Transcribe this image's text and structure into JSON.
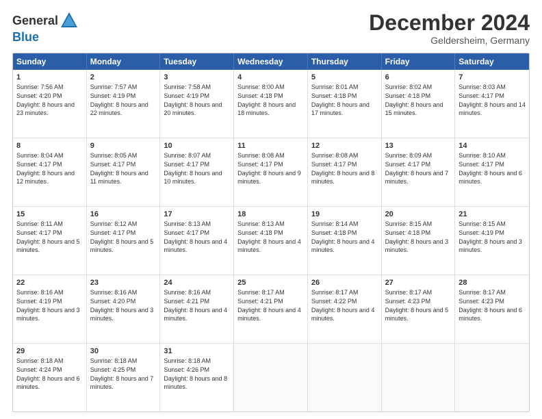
{
  "header": {
    "logo_general": "General",
    "logo_blue": "Blue",
    "month_title": "December 2024",
    "location": "Geldersheim, Germany"
  },
  "weekdays": [
    "Sunday",
    "Monday",
    "Tuesday",
    "Wednesday",
    "Thursday",
    "Friday",
    "Saturday"
  ],
  "rows": [
    [
      {
        "day": "1",
        "sunrise": "Sunrise: 7:56 AM",
        "sunset": "Sunset: 4:20 PM",
        "daylight": "Daylight: 8 hours and 23 minutes."
      },
      {
        "day": "2",
        "sunrise": "Sunrise: 7:57 AM",
        "sunset": "Sunset: 4:19 PM",
        "daylight": "Daylight: 8 hours and 22 minutes."
      },
      {
        "day": "3",
        "sunrise": "Sunrise: 7:58 AM",
        "sunset": "Sunset: 4:19 PM",
        "daylight": "Daylight: 8 hours and 20 minutes."
      },
      {
        "day": "4",
        "sunrise": "Sunrise: 8:00 AM",
        "sunset": "Sunset: 4:18 PM",
        "daylight": "Daylight: 8 hours and 18 minutes."
      },
      {
        "day": "5",
        "sunrise": "Sunrise: 8:01 AM",
        "sunset": "Sunset: 4:18 PM",
        "daylight": "Daylight: 8 hours and 17 minutes."
      },
      {
        "day": "6",
        "sunrise": "Sunrise: 8:02 AM",
        "sunset": "Sunset: 4:18 PM",
        "daylight": "Daylight: 8 hours and 15 minutes."
      },
      {
        "day": "7",
        "sunrise": "Sunrise: 8:03 AM",
        "sunset": "Sunset: 4:17 PM",
        "daylight": "Daylight: 8 hours and 14 minutes."
      }
    ],
    [
      {
        "day": "8",
        "sunrise": "Sunrise: 8:04 AM",
        "sunset": "Sunset: 4:17 PM",
        "daylight": "Daylight: 8 hours and 12 minutes."
      },
      {
        "day": "9",
        "sunrise": "Sunrise: 8:05 AM",
        "sunset": "Sunset: 4:17 PM",
        "daylight": "Daylight: 8 hours and 11 minutes."
      },
      {
        "day": "10",
        "sunrise": "Sunrise: 8:07 AM",
        "sunset": "Sunset: 4:17 PM",
        "daylight": "Daylight: 8 hours and 10 minutes."
      },
      {
        "day": "11",
        "sunrise": "Sunrise: 8:08 AM",
        "sunset": "Sunset: 4:17 PM",
        "daylight": "Daylight: 8 hours and 9 minutes."
      },
      {
        "day": "12",
        "sunrise": "Sunrise: 8:08 AM",
        "sunset": "Sunset: 4:17 PM",
        "daylight": "Daylight: 8 hours and 8 minutes."
      },
      {
        "day": "13",
        "sunrise": "Sunrise: 8:09 AM",
        "sunset": "Sunset: 4:17 PM",
        "daylight": "Daylight: 8 hours and 7 minutes."
      },
      {
        "day": "14",
        "sunrise": "Sunrise: 8:10 AM",
        "sunset": "Sunset: 4:17 PM",
        "daylight": "Daylight: 8 hours and 6 minutes."
      }
    ],
    [
      {
        "day": "15",
        "sunrise": "Sunrise: 8:11 AM",
        "sunset": "Sunset: 4:17 PM",
        "daylight": "Daylight: 8 hours and 5 minutes."
      },
      {
        "day": "16",
        "sunrise": "Sunrise: 8:12 AM",
        "sunset": "Sunset: 4:17 PM",
        "daylight": "Daylight: 8 hours and 5 minutes."
      },
      {
        "day": "17",
        "sunrise": "Sunrise: 8:13 AM",
        "sunset": "Sunset: 4:17 PM",
        "daylight": "Daylight: 8 hours and 4 minutes."
      },
      {
        "day": "18",
        "sunrise": "Sunrise: 8:13 AM",
        "sunset": "Sunset: 4:18 PM",
        "daylight": "Daylight: 8 hours and 4 minutes."
      },
      {
        "day": "19",
        "sunrise": "Sunrise: 8:14 AM",
        "sunset": "Sunset: 4:18 PM",
        "daylight": "Daylight: 8 hours and 4 minutes."
      },
      {
        "day": "20",
        "sunrise": "Sunrise: 8:15 AM",
        "sunset": "Sunset: 4:18 PM",
        "daylight": "Daylight: 8 hours and 3 minutes."
      },
      {
        "day": "21",
        "sunrise": "Sunrise: 8:15 AM",
        "sunset": "Sunset: 4:19 PM",
        "daylight": "Daylight: 8 hours and 3 minutes."
      }
    ],
    [
      {
        "day": "22",
        "sunrise": "Sunrise: 8:16 AM",
        "sunset": "Sunset: 4:19 PM",
        "daylight": "Daylight: 8 hours and 3 minutes."
      },
      {
        "day": "23",
        "sunrise": "Sunrise: 8:16 AM",
        "sunset": "Sunset: 4:20 PM",
        "daylight": "Daylight: 8 hours and 3 minutes."
      },
      {
        "day": "24",
        "sunrise": "Sunrise: 8:16 AM",
        "sunset": "Sunset: 4:21 PM",
        "daylight": "Daylight: 8 hours and 4 minutes."
      },
      {
        "day": "25",
        "sunrise": "Sunrise: 8:17 AM",
        "sunset": "Sunset: 4:21 PM",
        "daylight": "Daylight: 8 hours and 4 minutes."
      },
      {
        "day": "26",
        "sunrise": "Sunrise: 8:17 AM",
        "sunset": "Sunset: 4:22 PM",
        "daylight": "Daylight: 8 hours and 4 minutes."
      },
      {
        "day": "27",
        "sunrise": "Sunrise: 8:17 AM",
        "sunset": "Sunset: 4:23 PM",
        "daylight": "Daylight: 8 hours and 5 minutes."
      },
      {
        "day": "28",
        "sunrise": "Sunrise: 8:17 AM",
        "sunset": "Sunset: 4:23 PM",
        "daylight": "Daylight: 8 hours and 6 minutes."
      }
    ],
    [
      {
        "day": "29",
        "sunrise": "Sunrise: 8:18 AM",
        "sunset": "Sunset: 4:24 PM",
        "daylight": "Daylight: 8 hours and 6 minutes."
      },
      {
        "day": "30",
        "sunrise": "Sunrise: 8:18 AM",
        "sunset": "Sunset: 4:25 PM",
        "daylight": "Daylight: 8 hours and 7 minutes."
      },
      {
        "day": "31",
        "sunrise": "Sunrise: 8:18 AM",
        "sunset": "Sunset: 4:26 PM",
        "daylight": "Daylight: 8 hours and 8 minutes."
      },
      null,
      null,
      null,
      null
    ]
  ]
}
